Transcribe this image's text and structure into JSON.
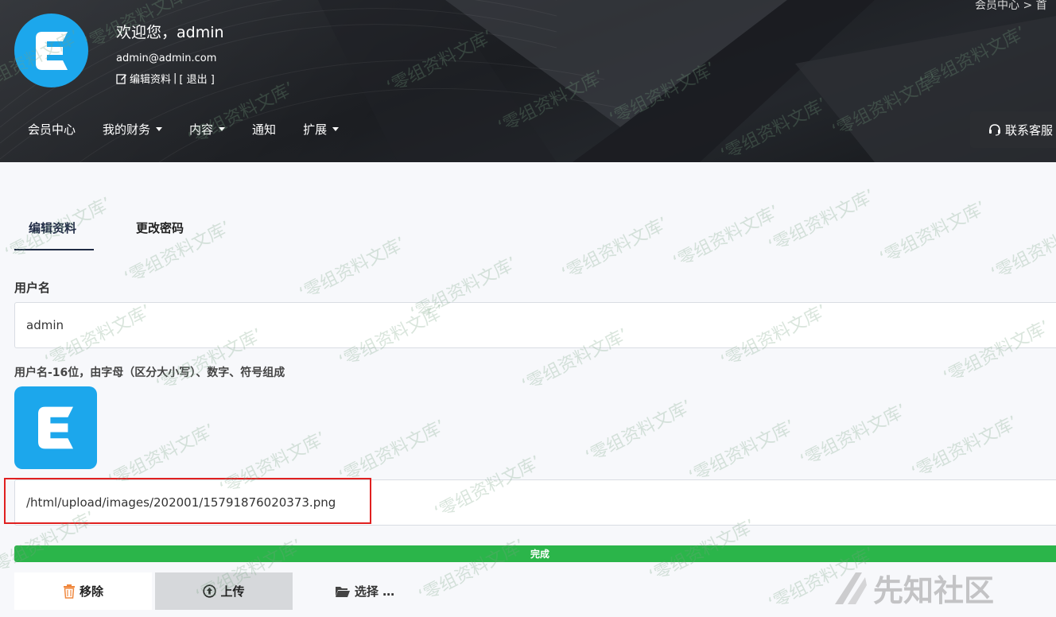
{
  "header": {
    "welcome": "欢迎您，admin",
    "email": "admin@admin.com",
    "edit_profile": "编辑资料",
    "separator": "|",
    "logout": "[ 退出 ]",
    "breadcrumb": "会员中心  >  首",
    "support": "联系客服"
  },
  "nav": {
    "items": [
      {
        "label": "会员中心",
        "dropdown": false
      },
      {
        "label": "我的财务",
        "dropdown": true
      },
      {
        "label": "内容",
        "dropdown": true
      },
      {
        "label": "通知",
        "dropdown": false
      },
      {
        "label": "扩展",
        "dropdown": true
      }
    ]
  },
  "tabs": [
    {
      "label": "编辑资料",
      "active": true
    },
    {
      "label": "更改密码",
      "active": false
    }
  ],
  "form": {
    "username_label": "用户名",
    "username_value": "admin",
    "username_hint": "用户名-16位，由字母（区分大小写）、数字、符号组成",
    "avatar_path": "/html/upload/images/202001/15791876020373.png",
    "progress_label": "完成",
    "progress": 1.0,
    "remove_label": "移除",
    "upload_label": "上传",
    "browse_label": "选择 …"
  },
  "watermark": {
    "text": "‘零组资料文库’",
    "brand": "先知社区"
  },
  "colors": {
    "logo_blue": "#1ca7ec",
    "progress_green": "#2bb54a",
    "highlight_red": "#e02020",
    "tab_underline": "#1f2a44"
  }
}
